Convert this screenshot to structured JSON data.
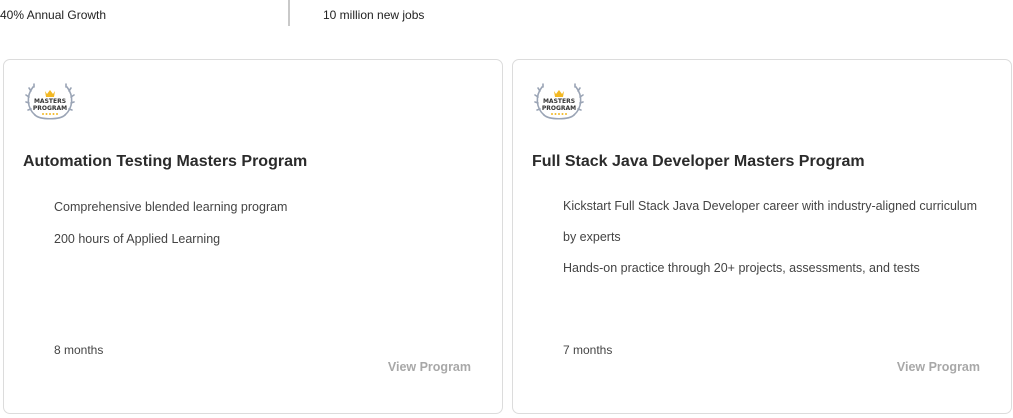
{
  "stats": {
    "growth": "40% Annual Growth",
    "jobs": "10 million new jobs"
  },
  "colors": {
    "gold": "#f2b824",
    "laurel": "#9aa4b5",
    "link": "#a8a8a8"
  },
  "cards": [
    {
      "badge_icon": "masters-program-badge-icon",
      "badge_line1": "MASTERS",
      "badge_line2": "PROGRAM",
      "title": "Automation Testing Masters Program",
      "features": [
        "Comprehensive blended learning program",
        "200 hours of Applied Learning"
      ],
      "duration": "8 months",
      "link": "View Program"
    },
    {
      "badge_icon": "masters-program-badge-icon",
      "badge_line1": "MASTERS",
      "badge_line2": "PROGRAM",
      "title": "Full Stack Java Developer Masters Program",
      "features": [
        "Kickstart Full Stack Java Developer career with industry-aligned curriculum by experts",
        "Hands-on practice through 20+ projects, assessments, and tests"
      ],
      "duration": "7 months",
      "link": "View Program"
    }
  ]
}
